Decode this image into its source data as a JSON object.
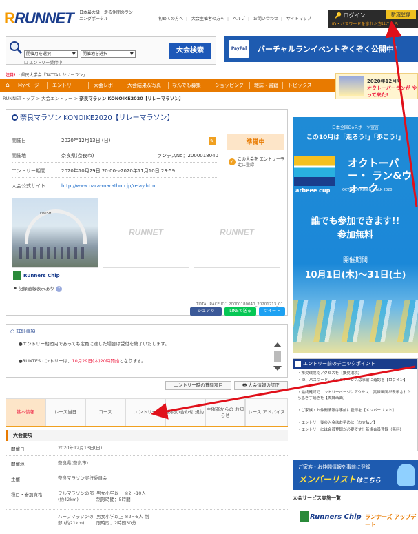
{
  "header": {
    "logo_text": "RUNNET",
    "tagline": "日本最大級！走る仲間のランニングポータル",
    "links": [
      "初めての方へ",
      "大会主催者の方へ",
      "ヘルプ",
      "お問い合わせ",
      "サイトマップ"
    ],
    "login_label": "ログイン",
    "register_label": "新規登録",
    "forgot_label": "ID・パスワードを忘れた方はこちら"
  },
  "search": {
    "select_region": "開催月を選択",
    "select_category": "開催地を選択",
    "checkbox_label": "エントリー受付中",
    "button_label": "大会検索"
  },
  "vr_banner": {
    "paypal": "PayPal",
    "text": "バーチャルランイベントぞくぞく公開中!"
  },
  "notice": {
    "tag": "注目!",
    "text": "・県民大学会「TATTAせかいーラン」"
  },
  "nav": {
    "home_icon": "home-icon",
    "items": [
      "Myページ",
      "エントリー",
      "大会レポ",
      "大会結果＆写真",
      "なんでも募集",
      "ショッピング",
      "雑誌・書籍",
      "トピックス"
    ]
  },
  "mini_banner": {
    "year": "2020年12月号",
    "text": "オクトーバーランが やって来た!"
  },
  "breadcrumb": {
    "items": [
      "RUNNETトップ",
      "大会エントリー"
    ],
    "current": "奈良マラソン KONOIKE2020【リレーマラソン】"
  },
  "race": {
    "title": "奈良マラソン KONOIKE2020【リレーマラソン】",
    "rows": [
      {
        "key": "開催日",
        "value": "2020年12月13日 (日)"
      },
      {
        "key": "開催地",
        "value": "奈良県(奈良市)",
        "extra": "ランテスNo：2000018040"
      },
      {
        "key": "エントリー期間",
        "value": "2020年10月29日 20:00～2020年11月10日 23:59"
      },
      {
        "key": "大会公式サイト",
        "value": "http://www.nara-marathon.jp/relay.html"
      }
    ],
    "status": "準備中",
    "plan_label": "この大会を エントリー予定に登録",
    "photo_logo": "RUNNET",
    "photo_banner": "FINISH",
    "runners_chip": "Runners Chip",
    "record_text": "記録速報表示あり",
    "total_id": "TOTAL RACE ID：20000180040_20201213_01"
  },
  "share": {
    "facebook": "シェア 0",
    "line": "LINEで送る",
    "twitter": "ツイート"
  },
  "details": {
    "title": "詳細事項",
    "line1": "●エントリー期間内であっても定員に達した場合は受付を終了いたします。",
    "line2_a": "●RUNTESエントリーは、",
    "line2_red": "10月29日(木)20時開始",
    "line2_b": "となります。"
  },
  "inquiry": {
    "faq": "エントリー時の質問項目",
    "contact": "大会情報の訂正"
  },
  "tabs": [
    "基本情報",
    "レース当日",
    "コース",
    "エントリー",
    "お問い合わせ 規約",
    "主催者からの お知らせ",
    "レース アドバイス"
  ],
  "section": {
    "title": "大会要項",
    "rows": [
      {
        "key": "開催日",
        "value": "2020年12月13日(日)"
      },
      {
        "key": "開催地",
        "value": "奈良県(奈良市)"
      },
      {
        "key": "主催",
        "value": "奈良マラソン実行委員会"
      },
      {
        "key": "種目・参加資格",
        "value": "フルマラソンの部 (約42km)",
        "value2": "男女小学以上 ※2～10人 制限時間：5時間"
      },
      {
        "key": "",
        "value": "ハーフマラソンの 部 (約21km)",
        "value2": "男女小学以上 ※2～5人 制限時間：2時間30分"
      }
    ]
  },
  "side_banner": {
    "small": "日本全国Doスポーツ宣言",
    "slogan": "この10月は「走ろう!」「歩こう!」",
    "big": "オクトーバー・ ラン&ウォーク",
    "cup": "arbeee cup",
    "event": "OCTOBER RUN & WALK 2020",
    "anyone": "誰でも参加できます!! 参加無料",
    "period_head": "開催期間",
    "period": "10月1日(木)～31日(土)"
  },
  "checkpoints": {
    "title": "エントリー前のチェックポイント",
    "items": [
      "・推奨環境でアクセスを【推奨環境】",
      "・ID、パスワード、メールアドレスは事前に確認を【ログイン】",
      "・最終確認でエントリーページにアクセス、実練画面が表示されたら急ぎ手続きを【実練画面】",
      "・ご家族・お仲間情報は事前に登録を【メンバーリスト】",
      "・エントリー後の入金はお早めに【お支払い】",
      "・エントリーには会員登録が必要です！新規会員登録（無料）"
    ]
  },
  "member_banner": {
    "top": "ご家族・お仲間情報を事前に登録",
    "big": "メンバーリスト",
    "small": "はこちら"
  },
  "services": {
    "title": "大会サービス実施一覧",
    "rc": "Runners Chip",
    "rt": "ランナーズ アップデート"
  },
  "colors": {
    "accent": "#e87a00",
    "brand": "#1a3d8c",
    "arrow": "#e0101a"
  }
}
